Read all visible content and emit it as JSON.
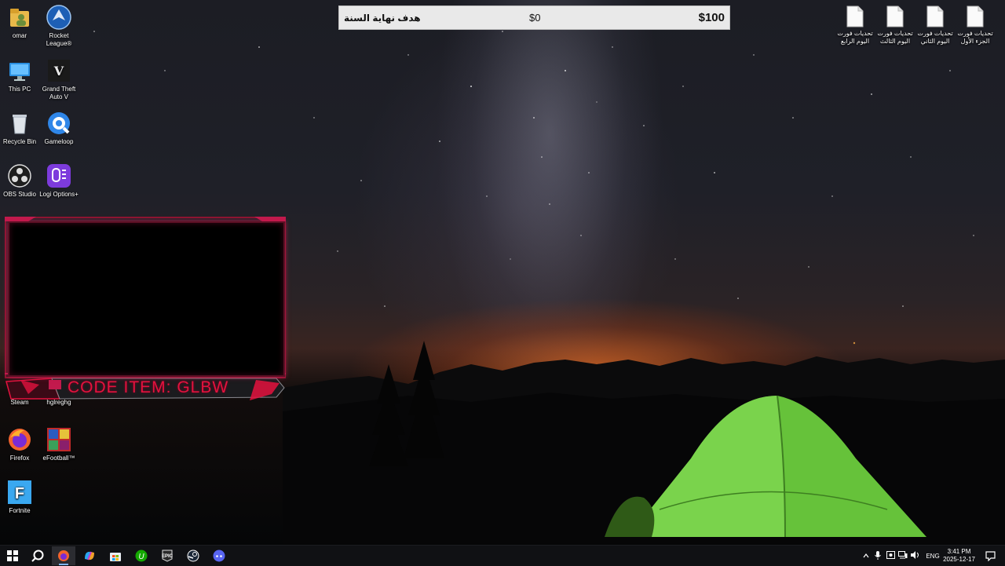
{
  "desktop": {
    "left_icons": [
      {
        "label": "omar"
      },
      {
        "label": "Rocket League®"
      },
      {
        "label": "This PC"
      },
      {
        "label": "Grand Theft Auto V"
      },
      {
        "label": "Recycle Bin"
      },
      {
        "label": "Gameloop"
      },
      {
        "label": "OBS Studio"
      },
      {
        "label": "Logi Options+"
      },
      {
        "label": "Steam"
      },
      {
        "label": "hglreghg"
      },
      {
        "label": "Firefox"
      },
      {
        "label": "eFootball™"
      },
      {
        "label": "Fortnite"
      }
    ],
    "right_files": [
      {
        "label": "تحديات فورت اليوم الرابع"
      },
      {
        "label": "تحديات فورت اليوم الثالث"
      },
      {
        "label": "تحديات فورت اليوم الثاني"
      },
      {
        "label": "تحديات فورت الجزء الأول"
      }
    ]
  },
  "goal_widget": {
    "title": "هدف نهاية السنة",
    "current": "$0",
    "target": "$100",
    "progress": 0
  },
  "stream_overlay": {
    "code_text": "CODE ITEM: GLBW",
    "accent": "#e4123e"
  },
  "taskbar": {
    "apps": [
      "start-icon",
      "search-icon",
      "firefox-icon",
      "copilot-icon",
      "store-icon",
      "upwork-icon",
      "epic-games-icon",
      "steam-icon",
      "discord-icon"
    ],
    "language": "ENG",
    "time": "3:41 PM",
    "date": "2025-12-17"
  }
}
